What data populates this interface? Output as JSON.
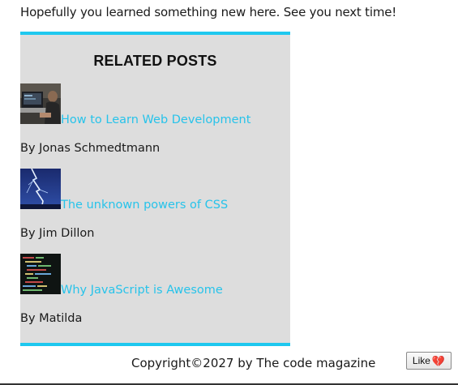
{
  "intro_text": "Hopefully you learned something new here. See you next time!",
  "related": {
    "heading": "RELATED POSTS",
    "posts": [
      {
        "title": "How to Learn Web Development",
        "author": "By Jonas Schmedtmann",
        "thumb_icon": "laptop-developer-photo"
      },
      {
        "title": "The unknown powers of CSS",
        "author": "By Jim Dillon",
        "thumb_icon": "lightning-photo"
      },
      {
        "title": "Why JavaScript is Awesome",
        "author": "By Matilda",
        "thumb_icon": "code-screen-photo"
      }
    ]
  },
  "footer": {
    "copyright": "Copyright©2027 by The code magazine"
  },
  "like_button": {
    "label": "Like",
    "icon": "broken-heart-icon"
  },
  "colors": {
    "accent": "#1ec8ef",
    "link": "#27c3ea",
    "panel_bg": "#dddddd"
  }
}
